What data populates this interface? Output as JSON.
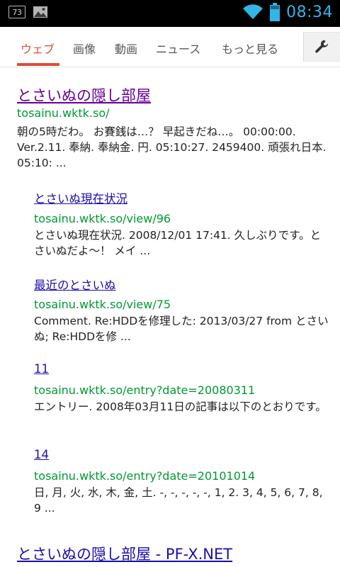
{
  "status_bar": {
    "notification_badge": "73",
    "clock": "08:34",
    "accent_color": "#33b5e5"
  },
  "tabs": [
    {
      "label": "ウェブ",
      "active": true
    },
    {
      "label": "画像",
      "active": false
    },
    {
      "label": "動画",
      "active": false
    },
    {
      "label": "ニュース",
      "active": false
    },
    {
      "label": "もっと見る",
      "active": false
    }
  ],
  "tools_icon": "wrench-icon",
  "results": [
    {
      "title": "とさいぬの隠し部屋",
      "url": "tosainu.wktk.so/",
      "snippet": "朝の5時だわ。 お賽銭は…？ 早起きだね…。 00:00:00. Ver.2.11. 奉納. 奉納金. 円. 05:10:27. 2459400. 頑張れ日本. 05:10: ...",
      "sitelinks": [
        {
          "title": "とさいぬ現在状況",
          "url": "tosainu.wktk.so/view/96",
          "snippet": "とさいぬ現在状況. 2008/12/01 17:41. 久しぶりです。とさいぬだよ～！ メイ ..."
        },
        {
          "title": "最近のとさいぬ",
          "url": "tosainu.wktk.so/view/75",
          "snippet": "Comment. Re:HDDを修理した: 2013/03/27 from とさいぬ; Re:HDDを修 ..."
        },
        {
          "title": "11",
          "url": "tosainu.wktk.so/entry?date=20080311",
          "snippet": "エントリー. 2008年03月11日の記事は以下のとおりです。"
        },
        {
          "title": "14",
          "url": "tosainu.wktk.so/entry?date=20101014",
          "snippet": "日, 月, 火, 水, 木, 金, 土. -, -, -, -, -, 1, 2. 3, 4, 5, 6, 7, 8, 9 ..."
        }
      ]
    },
    {
      "title": "とさいぬの隠し部屋 - PF-X.NET"
    }
  ]
}
